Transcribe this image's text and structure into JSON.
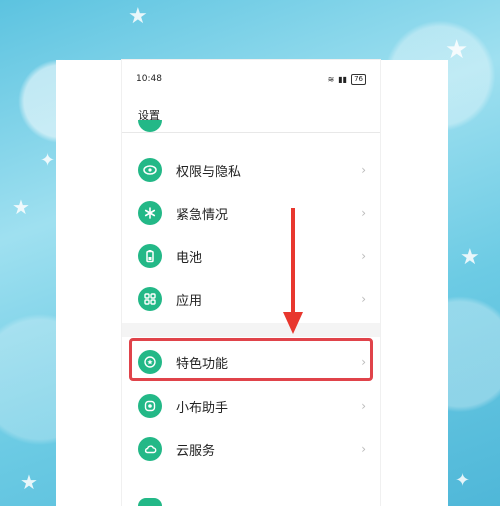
{
  "status_bar": {
    "time": "10:48",
    "battery": "76"
  },
  "header": {
    "title": "设置"
  },
  "settings": {
    "items": [
      {
        "label": "权限与隐私",
        "icon": "privacy-eye-icon"
      },
      {
        "label": "紧急情况",
        "icon": "emergency-asterisk-icon"
      },
      {
        "label": "电池",
        "icon": "battery-icon"
      },
      {
        "label": "应用",
        "icon": "apps-grid-icon"
      },
      {
        "label": "特色功能",
        "icon": "special-features-icon"
      },
      {
        "label": "小布助手",
        "icon": "breeno-assistant-icon"
      },
      {
        "label": "云服务",
        "icon": "cloud-icon"
      }
    ]
  },
  "colors": {
    "accent": "#23b887",
    "highlight": "#e0434a",
    "arrow": "#e8372e"
  }
}
